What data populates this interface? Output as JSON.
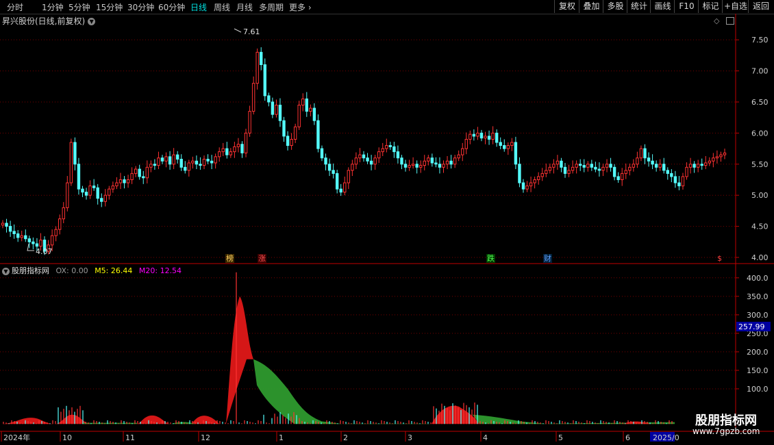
{
  "toolbar": {
    "periods": [
      "分时",
      "1分钟",
      "5分钟",
      "15分钟",
      "30分钟",
      "60分钟",
      "日线",
      "周线",
      "月线",
      "多周期",
      "更多"
    ],
    "active_period": "日线",
    "buttons": [
      "复权",
      "叠加",
      "多股",
      "统计",
      "画线",
      "F10",
      "标记",
      "+自选",
      "返回"
    ]
  },
  "main_chart": {
    "title": "昇兴股份(日线,前复权)",
    "high_label": "7.61",
    "low_label": "4.07",
    "y_ticks": [
      "7.50",
      "7.00",
      "6.50",
      "6.00",
      "5.50",
      "5.00",
      "4.50",
      "4.00"
    ],
    "markers": [
      {
        "text": "榜",
        "color": "#ffd060"
      },
      {
        "text": "涨",
        "color": "#ff5050"
      },
      {
        "text": "跌",
        "color": "#50ff50"
      },
      {
        "text": "财",
        "color": "#60a0ff"
      },
      {
        "text": "$",
        "color": "#ff4040"
      }
    ]
  },
  "indicator": {
    "name": "股朋指标网",
    "ox": "OX: 0.00",
    "m5": "M5: 26.44",
    "m20": "M20: 12.54",
    "y_ticks": [
      "400.0",
      "350.0",
      "300.0",
      "250.0",
      "200.0",
      "150.0",
      "100.0"
    ],
    "current_value": "257.99"
  },
  "x_axis": [
    "2024年",
    "10",
    "11",
    "12",
    "1",
    "2",
    "3",
    "4",
    "5",
    "6",
    "2025/0"
  ],
  "watermark": {
    "line1": "股朋指标网",
    "line2": "www.7gpzb.com"
  },
  "colors": {
    "up": "#ff3232",
    "down": "#54fcfc",
    "m5": "#ffff00",
    "m20": "#ff00ff",
    "ox": "#9a9a9a",
    "grid": "#7a0000",
    "axis": "#c00000"
  },
  "chart_data": {
    "type": "candlestick",
    "price_range": [
      4.0,
      7.7
    ],
    "close": [
      4.55,
      4.5,
      4.42,
      4.38,
      4.32,
      4.35,
      4.3,
      4.25,
      4.22,
      4.18,
      4.28,
      4.1,
      4.2,
      4.35,
      4.45,
      4.62,
      4.8,
      5.2,
      5.85,
      5.5,
      5.1,
      5.05,
      5.0,
      5.15,
      5.12,
      4.95,
      4.9,
      5.0,
      5.1,
      5.15,
      5.2,
      5.25,
      5.2,
      5.25,
      5.35,
      5.42,
      5.3,
      5.28,
      5.45,
      5.5,
      5.48,
      5.6,
      5.55,
      5.62,
      5.5,
      5.65,
      5.58,
      5.45,
      5.4,
      5.52,
      5.55,
      5.5,
      5.48,
      5.58,
      5.55,
      5.52,
      5.62,
      5.7,
      5.75,
      5.65,
      5.7,
      5.78,
      5.82,
      5.68,
      6.0,
      6.35,
      6.8,
      7.3,
      7.1,
      6.6,
      6.5,
      6.3,
      6.45,
      6.2,
      5.95,
      5.8,
      5.9,
      6.1,
      6.45,
      6.55,
      6.35,
      6.4,
      6.2,
      5.75,
      5.6,
      5.5,
      5.4,
      5.35,
      5.1,
      5.05,
      5.2,
      5.4,
      5.5,
      5.6,
      5.65,
      5.6,
      5.55,
      5.5,
      5.6,
      5.7,
      5.75,
      5.8,
      5.78,
      5.7,
      5.6,
      5.5,
      5.45,
      5.48,
      5.5,
      5.45,
      5.48,
      5.55,
      5.6,
      5.52,
      5.5,
      5.45,
      5.5,
      5.55,
      5.5,
      5.6,
      5.65,
      5.75,
      5.9,
      5.98,
      5.95,
      6.0,
      5.92,
      5.95,
      5.9,
      6.0,
      5.85,
      5.8,
      5.75,
      5.8,
      5.85,
      5.5,
      5.2,
      5.1,
      5.15,
      5.2,
      5.25,
      5.3,
      5.35,
      5.4,
      5.45,
      5.5,
      5.55,
      5.45,
      5.35,
      5.4,
      5.45,
      5.5,
      5.48,
      5.45,
      5.5,
      5.45,
      5.42,
      5.4,
      5.45,
      5.5,
      5.45,
      5.3,
      5.25,
      5.35,
      5.4,
      5.45,
      5.5,
      5.6,
      5.75,
      5.6,
      5.55,
      5.5,
      5.45,
      5.5,
      5.4,
      5.35,
      5.3,
      5.2,
      5.15,
      5.3,
      5.45,
      5.5,
      5.45,
      5.5,
      5.48,
      5.52,
      5.55,
      5.6,
      5.62,
      5.65,
      5.68
    ],
    "indicator_values": {
      "m5_band_peak": 350,
      "m20_band_peak": 175,
      "current": 257.99
    },
    "y_ticks_price": [
      7.5,
      7.0,
      6.5,
      6.0,
      5.5,
      5.0,
      4.5,
      4.0
    ],
    "y_ticks_indicator": [
      400,
      350,
      300,
      250,
      200,
      150,
      100
    ]
  }
}
